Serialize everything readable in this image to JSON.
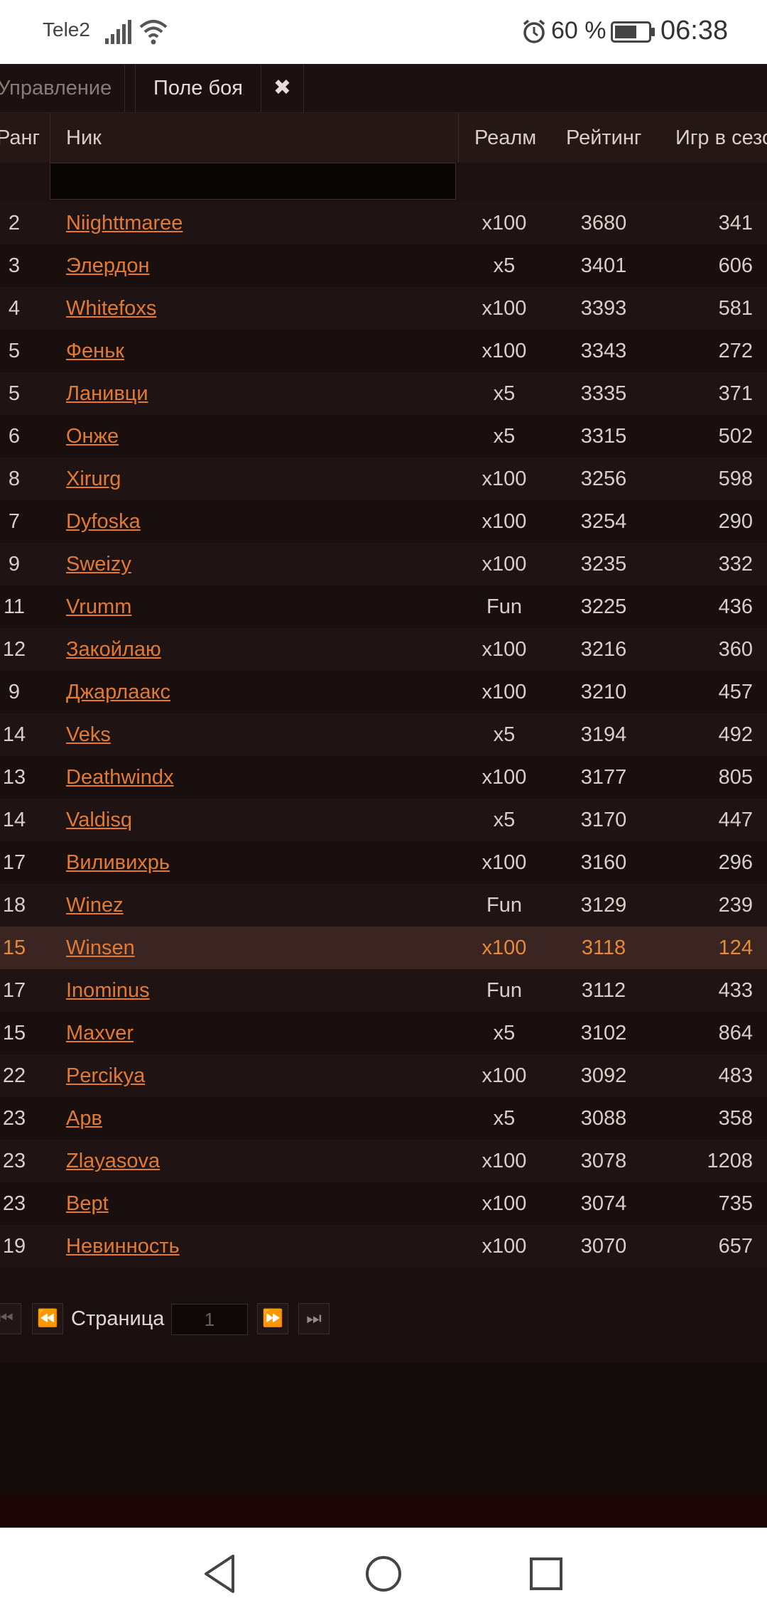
{
  "status_bar": {
    "carrier": "Tele2",
    "battery_percent": "60 %",
    "time": "06:38"
  },
  "tabs": {
    "manage": "Управление",
    "battle": "Поле боя",
    "close": "✖"
  },
  "table": {
    "columns": [
      "Ранг",
      "Ник",
      "Реалм",
      "Рейтинг",
      "Игр в сезо"
    ],
    "rows": [
      {
        "rank": "2",
        "nick": "Niighttmaree",
        "realm": "x100",
        "rating": "3680",
        "games": "341"
      },
      {
        "rank": "3",
        "nick": "Элердон",
        "realm": "x5",
        "rating": "3401",
        "games": "606"
      },
      {
        "rank": "4",
        "nick": "Whitefoxs",
        "realm": "x100",
        "rating": "3393",
        "games": "581"
      },
      {
        "rank": "5",
        "nick": "Феньк",
        "realm": "x100",
        "rating": "3343",
        "games": "272"
      },
      {
        "rank": "5",
        "nick": "Ланивци",
        "realm": "x5",
        "rating": "3335",
        "games": "371"
      },
      {
        "rank": "6",
        "nick": "Онже",
        "realm": "x5",
        "rating": "3315",
        "games": "502"
      },
      {
        "rank": "8",
        "nick": "Xirurg",
        "realm": "x100",
        "rating": "3256",
        "games": "598"
      },
      {
        "rank": "7",
        "nick": "Dyfoska",
        "realm": "x100",
        "rating": "3254",
        "games": "290"
      },
      {
        "rank": "9",
        "nick": "Sweizy",
        "realm": "x100",
        "rating": "3235",
        "games": "332"
      },
      {
        "rank": "11",
        "nick": "Vrumm",
        "realm": "Fun",
        "rating": "3225",
        "games": "436"
      },
      {
        "rank": "12",
        "nick": "Закойлаю",
        "realm": "x100",
        "rating": "3216",
        "games": "360"
      },
      {
        "rank": "9",
        "nick": "Джарлаакс",
        "realm": "x100",
        "rating": "3210",
        "games": "457"
      },
      {
        "rank": "14",
        "nick": "Veks",
        "realm": "x5",
        "rating": "3194",
        "games": "492"
      },
      {
        "rank": "13",
        "nick": "Deathwindx",
        "realm": "x100",
        "rating": "3177",
        "games": "805"
      },
      {
        "rank": "14",
        "nick": "Valdisq",
        "realm": "x5",
        "rating": "3170",
        "games": "447"
      },
      {
        "rank": "17",
        "nick": "Виливихрь",
        "realm": "x100",
        "rating": "3160",
        "games": "296"
      },
      {
        "rank": "18",
        "nick": "Winez",
        "realm": "Fun",
        "rating": "3129",
        "games": "239"
      },
      {
        "rank": "15",
        "nick": "Winsen",
        "realm": "x100",
        "rating": "3118",
        "games": "124",
        "highlight": true
      },
      {
        "rank": "17",
        "nick": "Inominus",
        "realm": "Fun",
        "rating": "3112",
        "games": "433"
      },
      {
        "rank": "15",
        "nick": "Maxver",
        "realm": "x5",
        "rating": "3102",
        "games": "864"
      },
      {
        "rank": "22",
        "nick": "Percikya",
        "realm": "x100",
        "rating": "3092",
        "games": "483"
      },
      {
        "rank": "23",
        "nick": "Арв",
        "realm": "x5",
        "rating": "3088",
        "games": "358"
      },
      {
        "rank": "23",
        "nick": "Zlayasova",
        "realm": "x100",
        "rating": "3078",
        "games": "1208"
      },
      {
        "rank": "23",
        "nick": "Вept",
        "realm": "x100",
        "rating": "3074",
        "games": "735"
      },
      {
        "rank": "19",
        "nick": "Невинность",
        "realm": "x100",
        "rating": "3070",
        "games": "657"
      }
    ]
  },
  "pager": {
    "label": "Страница",
    "page": "1"
  },
  "colors": {
    "accent": "#e07a35",
    "background": "#150b0b",
    "highlight_row": "#3a2522"
  }
}
